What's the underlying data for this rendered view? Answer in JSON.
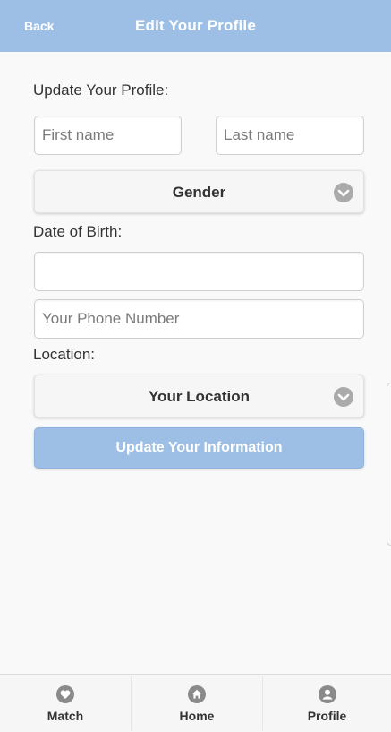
{
  "header": {
    "back_label": "Back",
    "title": "Edit Your Profile",
    "color": "#9dbfe6"
  },
  "form": {
    "section_label": "Update Your Profile:",
    "first_name": {
      "value": "",
      "placeholder": "First name"
    },
    "last_name": {
      "value": "",
      "placeholder": "Last name"
    },
    "gender_select": {
      "selected": "Gender",
      "icon": "chevron-down-icon"
    },
    "dob_label": "Date of Birth:",
    "dob": {
      "value": "",
      "placeholder": ""
    },
    "phone": {
      "value": "",
      "placeholder": "Your Phone Number"
    },
    "location_label": "Location:",
    "location_select": {
      "selected": "Your Location",
      "icon": "chevron-down-icon"
    },
    "submit_label": "Update Your Information"
  },
  "nav": {
    "items": [
      {
        "label": "Match",
        "icon": "heart-icon"
      },
      {
        "label": "Home",
        "icon": "home-icon"
      },
      {
        "label": "Profile",
        "icon": "user-icon"
      }
    ]
  }
}
